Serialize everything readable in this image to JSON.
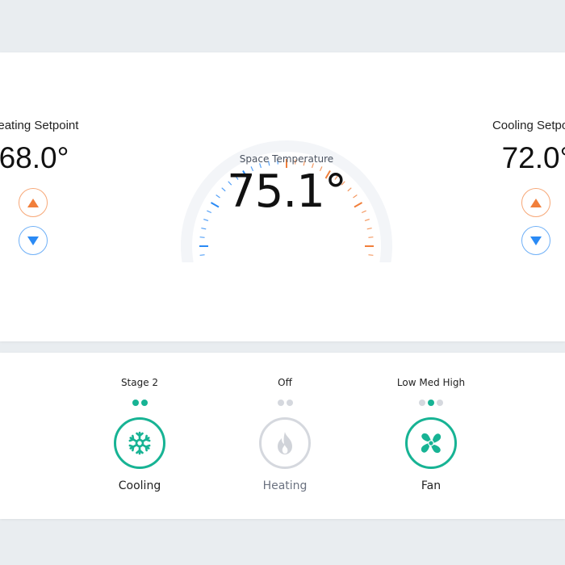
{
  "heating": {
    "label": "Heating Setpoint",
    "value": "68.0°"
  },
  "cooling": {
    "label": "Cooling Setpoint",
    "value": "72.0°"
  },
  "space": {
    "label": "Space Temperature",
    "value": "75.1°"
  },
  "modes": [
    {
      "name": "Cooling",
      "status": "Stage 2",
      "icon": "snowflake-icon",
      "active": true,
      "dots": [
        true,
        true
      ]
    },
    {
      "name": "Heating",
      "status": "Off",
      "icon": "flame-icon",
      "active": false,
      "dots": [
        false,
        false
      ]
    },
    {
      "name": "Fan",
      "status": "Low Med High",
      "icon": "fan-icon",
      "active": true,
      "dots": [
        false,
        true,
        false
      ]
    }
  ],
  "colors": {
    "heat": "#f17f3b",
    "cool": "#2a8af5",
    "active": "#17b394",
    "inactive": "#d5d8de"
  }
}
